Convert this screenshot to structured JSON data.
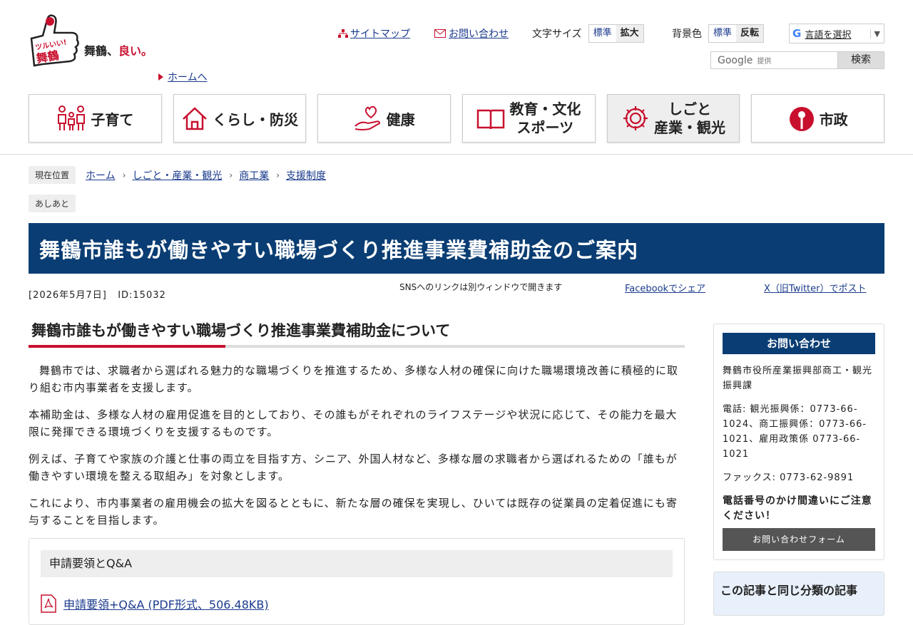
{
  "header": {
    "logo_text_a": "ツルいい!",
    "logo_text_b": "舞鶴",
    "tagline_a": "舞鶴、",
    "tagline_b": "良い。",
    "home_link": "ホームへ",
    "sitemap": "サイトマップ",
    "contact": "お問い合わせ",
    "font_size_label": "文字サイズ",
    "font_size_options": [
      "標準",
      "拡大"
    ],
    "bg_color_label": "背景色",
    "bg_color_options": [
      "標準",
      "反転"
    ],
    "language_select": "言語を選択",
    "search_brand": "Google",
    "search_provided": "提供",
    "search_button": "検索"
  },
  "nav": [
    {
      "label": "子育て",
      "icon": "family-icon"
    },
    {
      "label": "くらし・防災",
      "icon": "house-icon"
    },
    {
      "label": "健康",
      "icon": "heart-hand-icon"
    },
    {
      "label_line1": "教育・文化",
      "label_line2": "スポーツ",
      "icon": "book-icon"
    },
    {
      "label_line1": "しごと",
      "label_line2": "産業・観光",
      "icon": "gear-icon",
      "active": true
    },
    {
      "label": "市政",
      "icon": "city-mark-icon"
    }
  ],
  "breadcrumb": {
    "badge": "現在位置",
    "items": [
      "ホーム",
      "しごと・産業・観光",
      "商工業",
      "支援制度"
    ],
    "ashiato": "あしあと"
  },
  "page": {
    "title": "舞鶴市誰もが働きやすい職場づくり推進事業費補助金のご案内",
    "date": "[2026年5月7日]",
    "id": "ID:15032",
    "sns_note": "SNSへのリンクは別ウィンドウで開きます",
    "share_facebook": "Facebookでシェア",
    "share_x": "X（旧Twitter）でポスト"
  },
  "main": {
    "heading": "舞鶴市誰もが働きやすい職場づくり推進事業費補助金について",
    "paragraphs": [
      "舞鶴市では、求職者から選ばれる魅力的な職場づくりを推進するため、多様な人材の確保に向けた職場環境改善に積極的に取り組む市内事業者を支援します。",
      "本補助金は、多様な人材の雇用促進を目的としており、その誰もがそれぞれのライフステージや状況に応じて、その能力を最大限に発揮できる環境づくりを支援するものです。",
      "例えば、子育てや家族の介護と仕事の両立を目指す方、シニア、外国人材など、多様な層の求職者から選ばれるための「誰もが働きやすい環境を整える取組み」を対象とします。",
      "これにより、市内事業者の雇用機会の拡大を図るとともに、新たな層の確保を実現し、ひいては既存の従業員の定着促進にも寄与することを目指します。"
    ],
    "doc_heading": "申請要領とQ&A",
    "doc_link": "申請要領+Q&A (PDF形式、506.48KB)"
  },
  "sidebar": {
    "contact_title": "お問い合わせ",
    "dept": "舞鶴市役所産業振興部商工・観光振興課",
    "phone": "電話: 観光振興係：0773-66-1024、商工振興係：0773-66-1021、雇用政策係 0773-66-1021",
    "fax": "ファックス: 0773-62-9891",
    "warning": "電話番号のかけ間違いにご注意ください！",
    "form_button": "お問い合わせフォーム",
    "related_title": "この記事と同じ分類の記事"
  },
  "colors": {
    "navy": "#0a3d73",
    "accent_red": "#c8102e"
  }
}
